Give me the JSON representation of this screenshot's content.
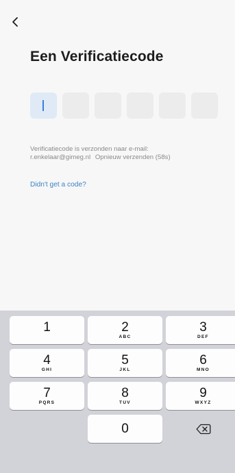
{
  "header": {
    "back_icon": "chevron-left-icon",
    "title": "Een Verificatiecode"
  },
  "code_input": {
    "box_count": 6,
    "active_index": 0,
    "values": [
      "",
      "",
      "",
      "",
      "",
      ""
    ]
  },
  "info": {
    "line1": "Verificatiecode is verzonden naar e-mail:",
    "email": "r.enkelaar@gimeg.nl",
    "resend_label": "Opnieuw verzenden (58s)"
  },
  "help_link": "Didn't get a code?",
  "keypad": {
    "keys": [
      {
        "digit": "1",
        "letters": ""
      },
      {
        "digit": "2",
        "letters": "ABC"
      },
      {
        "digit": "3",
        "letters": "DEF"
      },
      {
        "digit": "4",
        "letters": "GHI"
      },
      {
        "digit": "5",
        "letters": "JKL"
      },
      {
        "digit": "6",
        "letters": "MNO"
      },
      {
        "digit": "7",
        "letters": "PQRS"
      },
      {
        "digit": "8",
        "letters": "TUV"
      },
      {
        "digit": "9",
        "letters": "WXYZ"
      },
      {
        "digit": "0",
        "letters": ""
      }
    ],
    "delete_icon": "backspace-icon"
  },
  "colors": {
    "background": "#f7f7f7",
    "link": "#3b83c4",
    "active_box": "#dfeaf6",
    "keyboard": "#d2d3d8"
  }
}
